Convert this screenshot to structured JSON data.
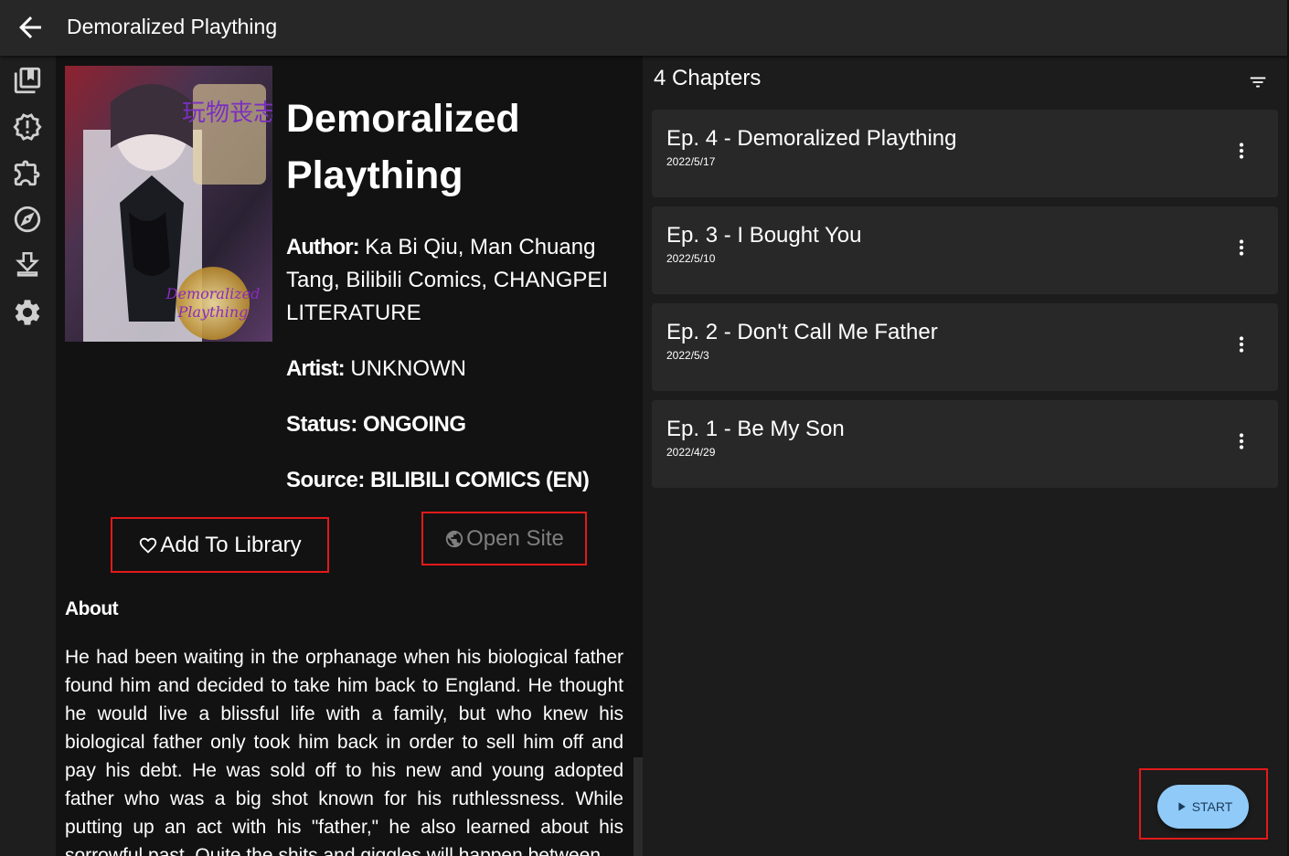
{
  "header": {
    "title": "Demoralized Plaything"
  },
  "sidebar": {
    "items": [
      {
        "icon": "library-icon"
      },
      {
        "icon": "updates-icon"
      },
      {
        "icon": "extensions-icon"
      },
      {
        "icon": "explore-icon"
      },
      {
        "icon": "downloads-icon"
      },
      {
        "icon": "settings-icon"
      }
    ]
  },
  "manga": {
    "title_line1": "Demoralized",
    "title_line2": "Plaything",
    "author_label": "Author:",
    "author_value": " Ka Bi Qiu, Man Chuang Tang, Bilibili Comics, CHANGPEI LITERATURE",
    "artist_label": "Artist:",
    "artist_value": " UNKNOWN",
    "status_label": "Status:",
    "status_value": " ONGOING",
    "source_label": "Source:",
    "source_value": " BILIBILI COMICS (EN)",
    "cover_text_cn": "玩物丧志",
    "cover_logo_line1": "Demoralized",
    "cover_logo_line2": "Plaything"
  },
  "actions": {
    "add_library": "Add To Library",
    "open_site": "Open Site"
  },
  "about": {
    "heading": "About",
    "text": "He had been waiting in the orphanage when his biological father found him and decided to take him back to England. He thought he would live a blissful life with a family, but who knew his biological father only took him back in order to sell him off and pay his debt. He was sold off to his new and young adopted father who was a big shot known for his ruthlessness. While putting up an act with his \"father,\" he also learned about his sorrowful past. Quite the shits and giggles will happen between"
  },
  "chapters": {
    "count_label": "4 Chapters",
    "items": [
      {
        "name": "Ep. 4 - Demoralized Plaything",
        "date": "2022/5/17"
      },
      {
        "name": "Ep. 3 - I Bought You",
        "date": "2022/5/10"
      },
      {
        "name": "Ep. 2 - Don't Call Me Father",
        "date": "2022/5/3"
      },
      {
        "name": "Ep. 1 - Be My Son",
        "date": "2022/4/29"
      }
    ]
  },
  "fab": {
    "label": "START"
  },
  "colors": {
    "accent": "#90caf9",
    "highlight": "#e3191b",
    "appbar": "#272727"
  }
}
